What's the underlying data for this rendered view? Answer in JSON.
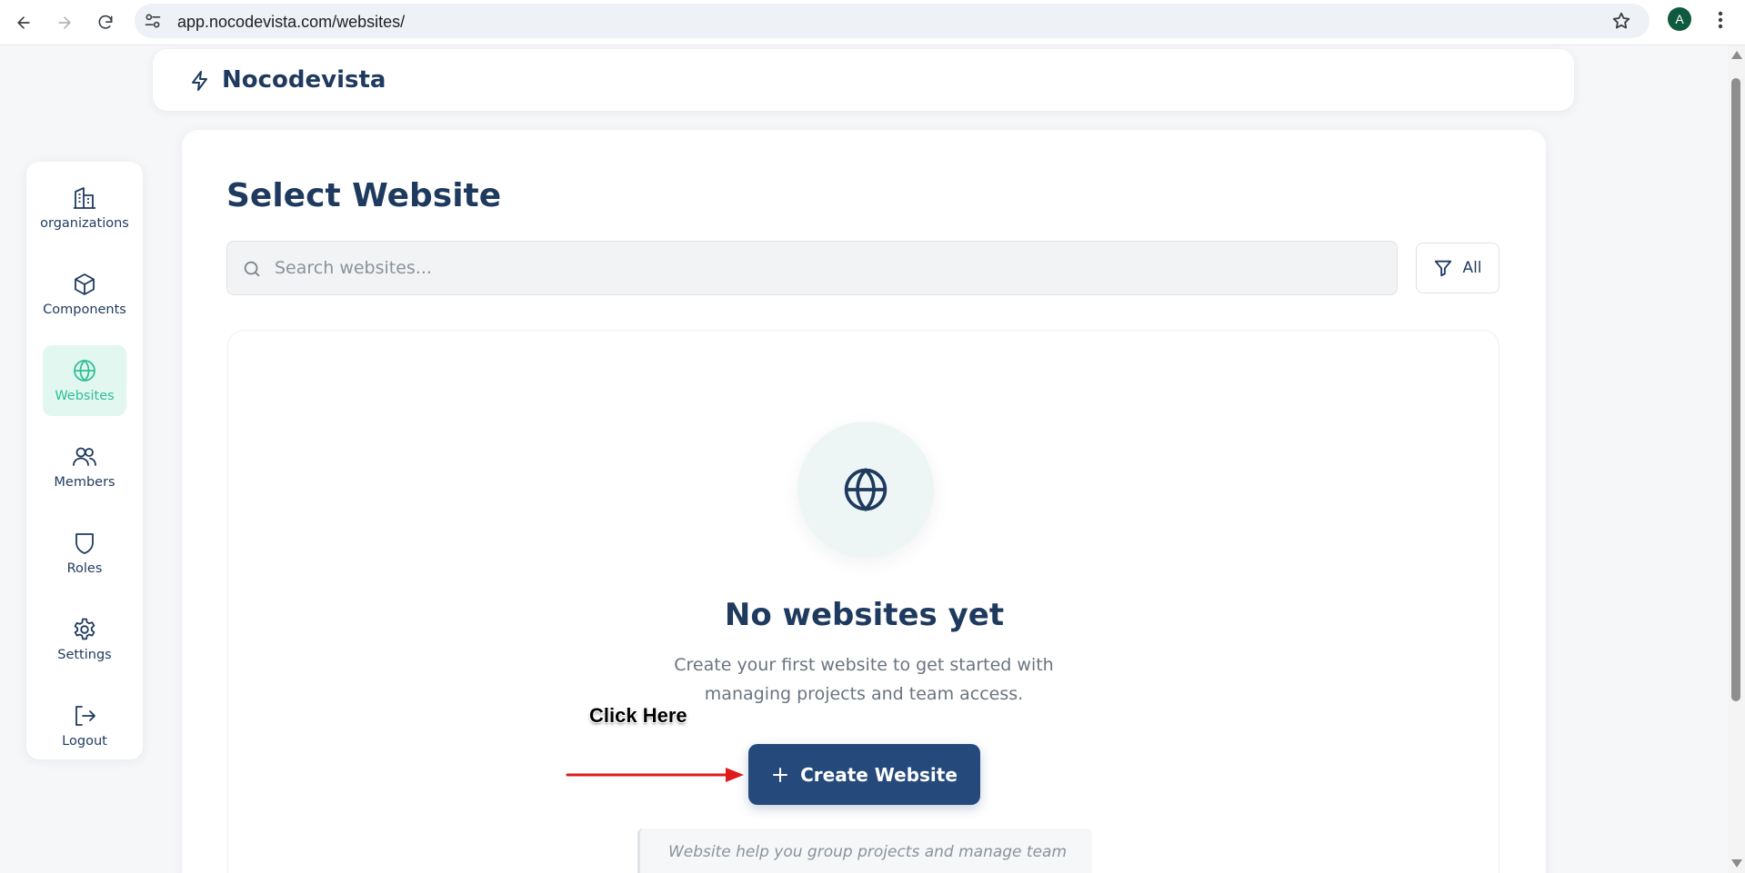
{
  "browser": {
    "url": "app.nocodevista.com/websites/",
    "profile_initial": "A"
  },
  "header": {
    "brand": "Nocodevista"
  },
  "sidebar": {
    "items": [
      {
        "label": "organizations",
        "icon": "building-icon"
      },
      {
        "label": "Components",
        "icon": "cube-icon"
      },
      {
        "label": "Websites",
        "icon": "globe-icon",
        "active": true
      },
      {
        "label": "Members",
        "icon": "users-icon"
      },
      {
        "label": "Roles",
        "icon": "shield-icon"
      },
      {
        "label": "Settings",
        "icon": "gear-icon"
      },
      {
        "label": "Logout",
        "icon": "logout-icon"
      }
    ]
  },
  "main": {
    "title": "Select Website",
    "search_placeholder": "Search websites...",
    "filter_label": "All",
    "empty": {
      "title": "No websites yet",
      "description": "Create your first website to get started with managing projects and team access.",
      "button_label": "Create Website",
      "hint": "Website help you group projects and manage team"
    }
  },
  "annotation": {
    "label": "Click Here"
  },
  "colors": {
    "primary": "#1f3a5f",
    "button": "#24497a",
    "accent": "#2fbf95",
    "active_bg": "#e3f7f1",
    "arrow": "#e01b1b"
  }
}
